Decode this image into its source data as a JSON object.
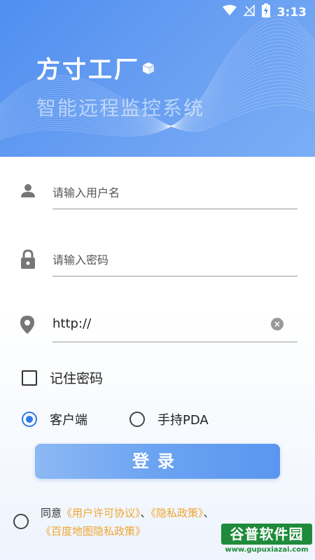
{
  "status_bar": {
    "time": "3:13"
  },
  "header": {
    "app_title": "方寸工厂",
    "app_subtitle": "智能远程监控系统"
  },
  "form": {
    "username_placeholder": "请输入用户名",
    "password_placeholder": "请输入密码",
    "server_value": "http://",
    "remember_label": "记住密码",
    "mode_options": [
      {
        "label": "客户端",
        "selected": true
      },
      {
        "label": "手持PDA",
        "selected": false
      }
    ],
    "login_label": "登录"
  },
  "agreement": {
    "prefix": "同意",
    "link1": "《用户许可协议》",
    "sep1": "、",
    "link2": "《隐私政策》",
    "sep2": "、",
    "link3": "《百度地图隐私政策》"
  },
  "watermark": {
    "brand": "谷普软件园",
    "url": "www.gupuxiazai.com"
  },
  "colors": {
    "header_blue": "#4f8ef0",
    "accent_blue": "#2f7ae5",
    "link_orange": "#f0a531",
    "watermark_green": "#1f8b3a"
  }
}
